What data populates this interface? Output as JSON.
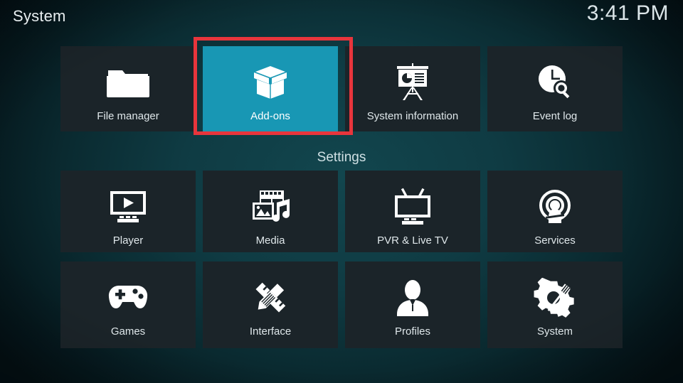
{
  "header": {
    "title": "System",
    "clock": "3:41 PM"
  },
  "section": {
    "settings_label": "Settings"
  },
  "colors": {
    "selected_tile": "#1897b4",
    "tile_background": "#1b2429",
    "annotation": "#e8353c",
    "label_text": "#dfe7ea"
  },
  "top_row": [
    {
      "label": "File manager",
      "icon": "folder-icon",
      "selected": false
    },
    {
      "label": "Add-ons",
      "icon": "open-box-icon",
      "selected": true
    },
    {
      "label": "System information",
      "icon": "presentation-icon",
      "selected": false
    },
    {
      "label": "Event log",
      "icon": "clock-search-icon",
      "selected": false
    }
  ],
  "settings_row_1": [
    {
      "label": "Player",
      "icon": "monitor-play-icon",
      "selected": false
    },
    {
      "label": "Media",
      "icon": "media-stack-icon",
      "selected": false
    },
    {
      "label": "PVR & Live TV",
      "icon": "tv-antenna-icon",
      "selected": false
    },
    {
      "label": "Services",
      "icon": "broadcast-icon",
      "selected": false
    }
  ],
  "settings_row_2": [
    {
      "label": "Games",
      "icon": "gamepad-icon",
      "selected": false
    },
    {
      "label": "Interface",
      "icon": "pencil-ruler-icon",
      "selected": false
    },
    {
      "label": "Profiles",
      "icon": "person-bust-icon",
      "selected": false
    },
    {
      "label": "System",
      "icon": "gear-tool-icon",
      "selected": false
    }
  ],
  "annotation": {
    "target": "Add-ons",
    "shape": "rectangle"
  }
}
